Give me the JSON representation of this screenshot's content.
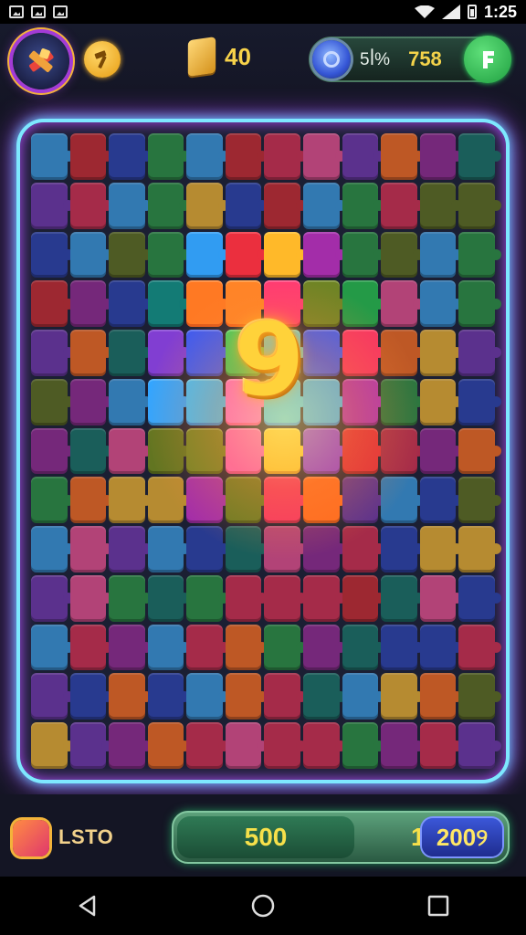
{
  "status_bar": {
    "time": "1:25",
    "icons": [
      "gallery-icon",
      "image-icon",
      "photo-icon",
      "wifi-icon",
      "signal-icon",
      "battery-icon"
    ]
  },
  "hud": {
    "avatar_icon": "crossed-hammer-icon",
    "tool_icon": "hammer-icon",
    "tickets": "40",
    "gem_percent": "5ꟾ%",
    "gems": "758",
    "add_icon": "plus-icon"
  },
  "board": {
    "countdown": "9",
    "piece_colors": [
      "#c23356",
      "#2f44a8",
      "#2f8a4a",
      "#8a2f8f",
      "#e0672c",
      "#3b8ed0",
      "#b92f3a",
      "#6b3aa6",
      "#d6a33a",
      "#1e6e6a",
      "#d14f8c",
      "#5c6b2a"
    ]
  },
  "bottom": {
    "level_label": "LSTO",
    "score": "500",
    "target_prefix": "1",
    "target": "200୨"
  },
  "nav": {
    "icons": [
      "back-icon",
      "home-icon",
      "recents-icon"
    ]
  },
  "colors": {
    "frame_glow": "#7ee8ff",
    "frame_outer_glow": "#b148ff",
    "accent_gold": "#f7d24a",
    "accent_green": "#2bd15c"
  }
}
